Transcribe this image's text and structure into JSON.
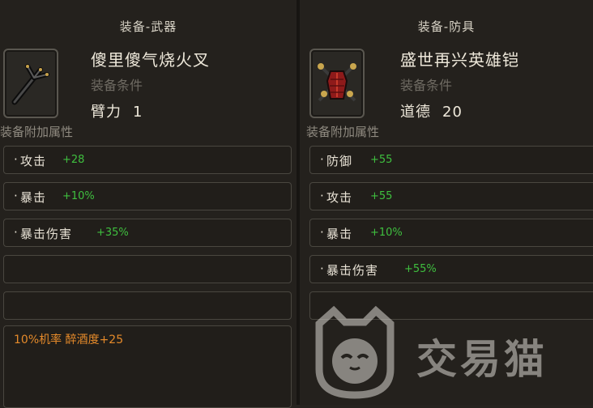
{
  "left_panel": {
    "title": "装备-武器",
    "item_name": "傻里傻气烧火叉",
    "requirement_label": "装备条件",
    "requirement": {
      "stat": "臂力",
      "value": "1"
    },
    "attributes_heading": "装备附加属性",
    "attributes": [
      {
        "name": "攻击",
        "value": "+28"
      },
      {
        "name": "暴击",
        "value": "+10%"
      },
      {
        "name": "暴击伤害",
        "value": "+35%"
      }
    ],
    "special_text": "10%机率 醉酒度+25",
    "icon": "fire-fork-icon"
  },
  "right_panel": {
    "title": "装备-防具",
    "item_name": "盛世再兴英雄铠",
    "requirement_label": "装备条件",
    "requirement": {
      "stat": "道德",
      "value": "20"
    },
    "attributes_heading": "装备附加属性",
    "attributes": [
      {
        "name": "防御",
        "value": "+55"
      },
      {
        "name": "攻击",
        "value": "+55"
      },
      {
        "name": "暴击",
        "value": "+10%"
      },
      {
        "name": "暴击伤害",
        "value": "+55%"
      }
    ],
    "icon": "hero-armor-icon"
  },
  "watermark": {
    "text": "交易猫",
    "icon": "cat-logo-icon"
  },
  "colors": {
    "bonus_green": "#3fbf3f",
    "special_orange": "#e58a2a",
    "background": "#24211d"
  }
}
